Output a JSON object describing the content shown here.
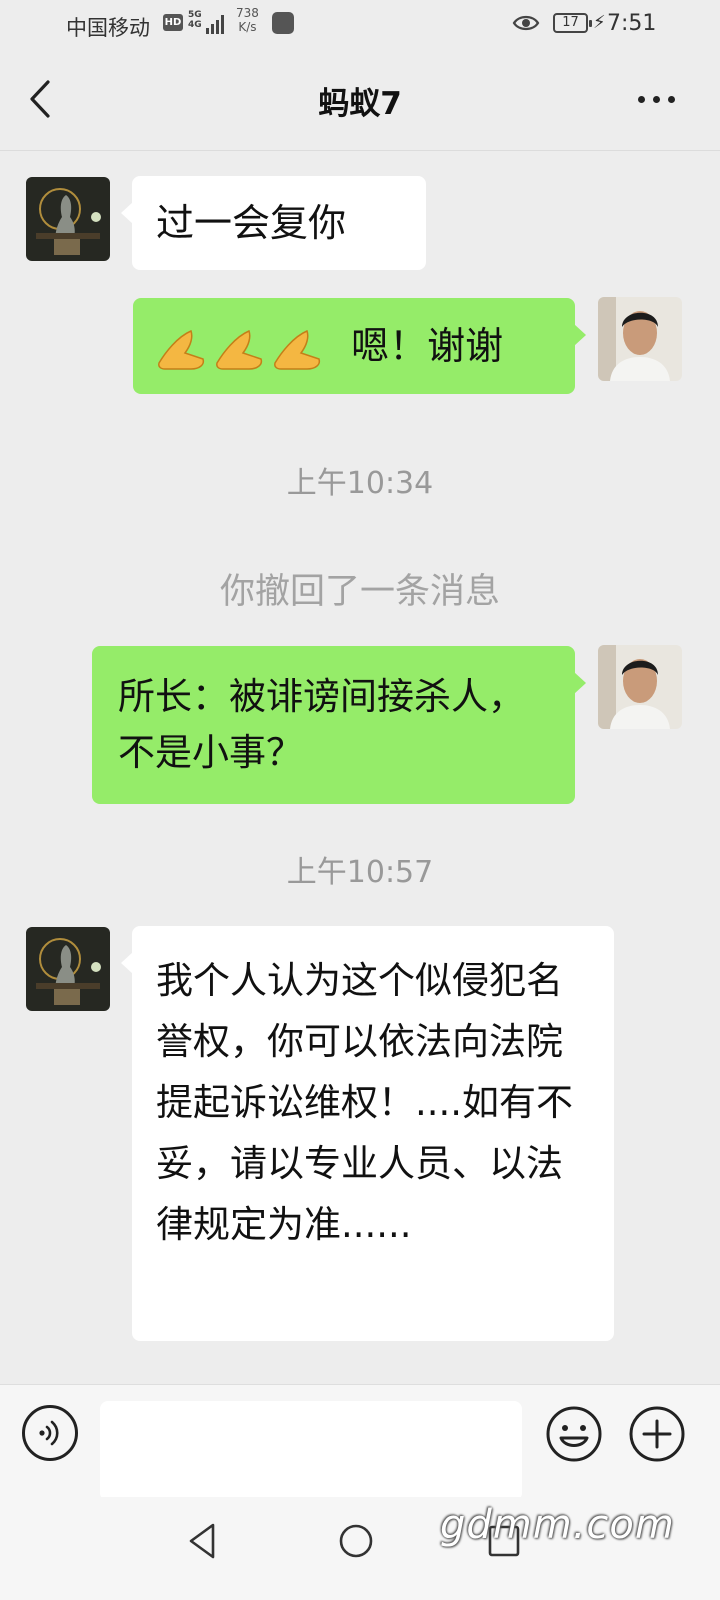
{
  "status_bar": {
    "carrier": "中国移动",
    "hd_badge": "HD",
    "network_top": "5G",
    "network_bottom": "4G",
    "speed_value": "738",
    "speed_unit": "K/s",
    "battery": "17",
    "time": "7:51"
  },
  "header": {
    "title": "蚂蚁7"
  },
  "messages": [
    {
      "sender": "contact",
      "text": "过一会复你"
    },
    {
      "sender": "me",
      "emoji": "🙏🙏🙏",
      "text": "嗯！谢谢"
    },
    {
      "timestamp": "上午10:34"
    },
    {
      "system": "你撤回了一条消息"
    },
    {
      "sender": "me",
      "text": "所长：被诽谤间接杀人，不是小事？"
    },
    {
      "timestamp": "上午10:57"
    },
    {
      "sender": "contact",
      "text": "我个人认为这个似侵犯名誉权，你可以依法向法院提起诉讼维权！....如有不妥，请以专业人员、以法律规定为准......"
    }
  ],
  "input": {
    "value": "",
    "placeholder": ""
  },
  "watermark": "gdmm.com",
  "colors": {
    "background": "#ededed",
    "outgoing_bubble": "#95ec69",
    "incoming_bubble": "#ffffff",
    "meta_text": "#999999"
  }
}
